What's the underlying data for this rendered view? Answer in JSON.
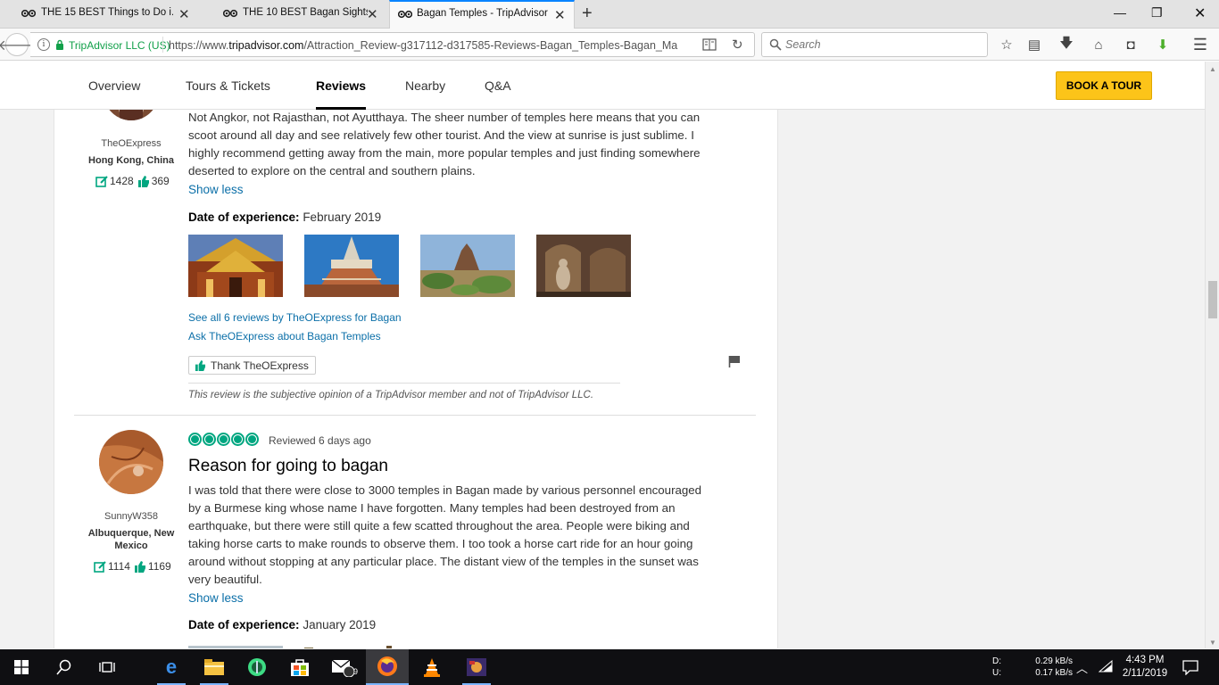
{
  "browser": {
    "tabs": [
      {
        "title": "THE 15 BEST Things to Do i...",
        "active": false
      },
      {
        "title": "THE 10 BEST Bagan Sights ...",
        "active": false
      },
      {
        "title": "Bagan Temples - TripAdvisor",
        "active": true
      }
    ],
    "identity": "TripAdvisor LLC (US)",
    "url_prefix": "https://www.",
    "url_domain": "tripadvisor.com",
    "url_path": "/Attraction_Review-g317112-d317585-Reviews-Bagan_Temples-Bagan_Ma",
    "search_placeholder": "Search"
  },
  "page_nav": {
    "items": [
      "Overview",
      "Tours & Tickets",
      "Reviews",
      "Nearby",
      "Q&A"
    ],
    "active": "Reviews",
    "book_tour": "BOOK A TOUR"
  },
  "review1": {
    "username": "TheOExpress",
    "location": "Hong Kong, China",
    "contributions": "1428",
    "helpful_votes": "369",
    "text": "Not Angkor, not Rajasthan, not Ayutthaya. The sheer number of temples here means that you can scoot around all day and see relatively few other tourist. And the view at sunrise is just sublime. I highly recommend getting away from the main, more popular temples and just finding somewhere deserted to explore on the central and southern plains.",
    "show_less": "Show less",
    "doe_label": "Date of experience:",
    "doe_value": "February 2019",
    "see_all": "See all 6 reviews by TheOExpress for Bagan",
    "ask": "Ask TheOExpress about Bagan Temples",
    "thank": "Thank TheOExpress",
    "disclaimer": "This review is the subjective opinion of a TripAdvisor member and not of TripAdvisor LLC."
  },
  "review2": {
    "username": "SunnyW358",
    "location": "Albuquerque, New Mexico",
    "contributions": "1114",
    "helpful_votes": "1169",
    "rating": 5,
    "reviewed": "Reviewed 6 days ago",
    "title": "Reason for going to bagan",
    "text": "I was told that there were close to 3000 temples in Bagan made by various personnel encouraged by a Burmese king whose name I have forgotten. Many temples had been destroyed from an earthquake, but there were still quite a few scatted throughout the area. People were biking and taking horse carts to make rounds to observe them. I too took a horse cart ride for an hour going around without stopping at any particular place. The distant view of the temples in the sunset was very beautiful.",
    "show_less": "Show less",
    "doe_label": "Date of experience:",
    "doe_value": "January 2019"
  },
  "taskbar": {
    "net_labels": "D:\nU:",
    "net_speeds": "0.29 kB/s\n0.17 kB/s",
    "mail_badge": "9",
    "time": "4:43 PM",
    "date": "2/11/2019"
  },
  "colors": {
    "accent_green": "#00a680",
    "link_blue": "#0b6fa8",
    "book_yellow": "#fcc419"
  }
}
